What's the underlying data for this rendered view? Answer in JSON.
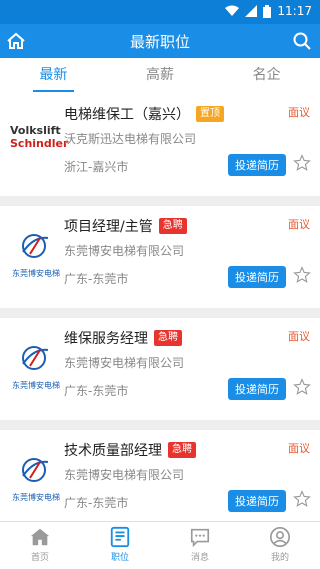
{
  "status": {
    "time": "11:17"
  },
  "header": {
    "title": "最新职位"
  },
  "tabs": [
    {
      "label": "最新",
      "active": true
    },
    {
      "label": "高薪",
      "active": false
    },
    {
      "label": "名企",
      "active": false
    }
  ],
  "jobs": [
    {
      "title": "电梯维保工（嘉兴）",
      "badge": "置顶",
      "badge_type": "top",
      "company": "沃克斯迅达电梯有限公司",
      "location": "浙江-嘉兴市",
      "salary": "面议",
      "apply_label": "投递简历",
      "logo": "Volkslift Schindler"
    },
    {
      "title": "项目经理/主管",
      "badge": "急聘",
      "badge_type": "urgent",
      "company": "东莞博安电梯有限公司",
      "location": "广东-东莞市",
      "salary": "面议",
      "apply_label": "投递简历",
      "logo": "东莞博安电梯"
    },
    {
      "title": "维保服务经理",
      "badge": "急聘",
      "badge_type": "urgent",
      "company": "东莞博安电梯有限公司",
      "location": "广东-东莞市",
      "salary": "面议",
      "apply_label": "投递简历",
      "logo": "东莞博安电梯"
    },
    {
      "title": "技术质量部经理",
      "badge": "急聘",
      "badge_type": "urgent",
      "company": "东莞博安电梯有限公司",
      "location": "广东-东莞市",
      "salary": "面议",
      "apply_label": "投递简历",
      "logo": "东莞博安电梯"
    }
  ],
  "bottom_nav": [
    {
      "label": "首页",
      "icon": "home-icon",
      "active": false
    },
    {
      "label": "职位",
      "icon": "jobs-icon",
      "active": true
    },
    {
      "label": "消息",
      "icon": "message-icon",
      "active": false
    },
    {
      "label": "我的",
      "icon": "profile-icon",
      "active": false
    }
  ],
  "colors": {
    "primary": "#1a8ee6",
    "status_bar": "#0d7fd6",
    "urgent": "#e8342e",
    "top": "#f6a623",
    "salary": "#e8582e"
  }
}
